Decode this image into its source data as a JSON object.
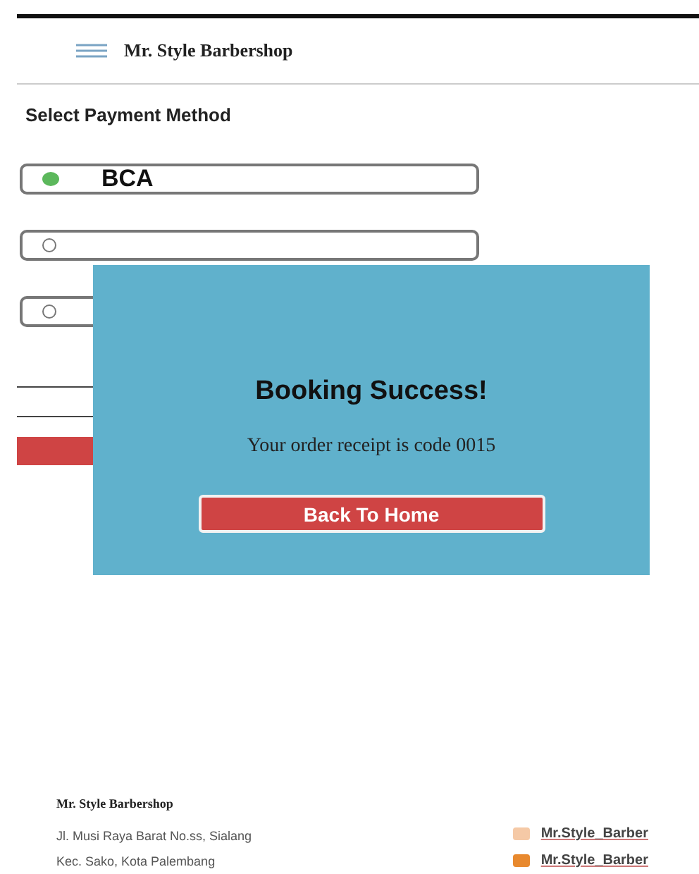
{
  "app_bar": {
    "title": "Mr. Style Barbershop"
  },
  "section_title": "Select Payment Method",
  "payment_options": [
    {
      "label": "BCA",
      "selected": true
    },
    {
      "selected": false
    },
    {
      "selected": false
    }
  ],
  "dialog": {
    "title": "Booking Success!",
    "message": "Your order receipt is code 0015",
    "button": "Back To Home"
  },
  "footer": {
    "name": "Mr. Style Barbershop",
    "address_lines": [
      "Jl. Musi Raya Barat No.ss, Sialang",
      "Kec. Sako, Kota Palembang"
    ],
    "socials": [
      {
        "kind": "instagram",
        "handle": "Mr.Style_Barber"
      },
      {
        "kind": "other",
        "handle": "Mr.Style_Barber"
      }
    ]
  }
}
